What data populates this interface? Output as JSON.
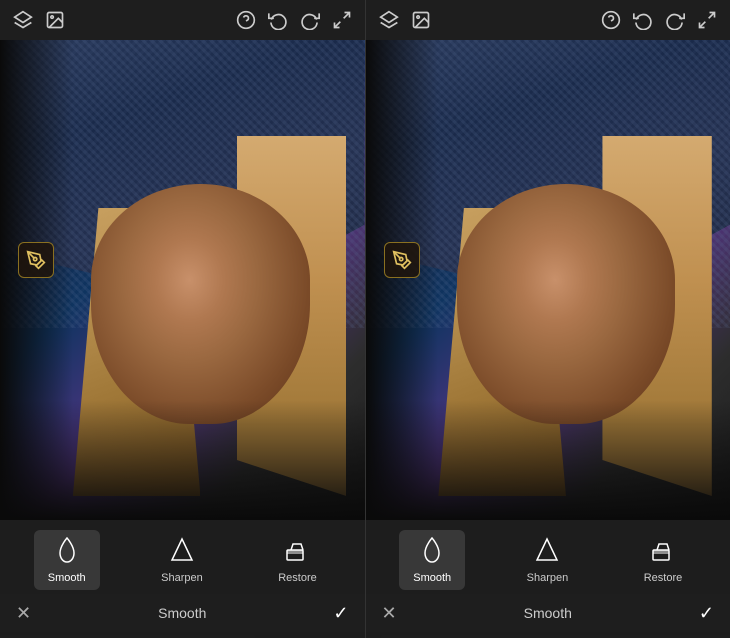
{
  "panels": [
    {
      "id": "left",
      "toolbar": {
        "left_icons": [
          "layers-icon",
          "image-icon"
        ],
        "right_icons": [
          "help-icon",
          "undo-icon",
          "redo-icon",
          "expand-icon"
        ]
      },
      "brush_indicator": true,
      "tools": [
        {
          "id": "smooth",
          "label": "Smooth",
          "icon": "drop",
          "active": true
        },
        {
          "id": "sharpen",
          "label": "Sharpen",
          "icon": "triangle"
        },
        {
          "id": "restore",
          "label": "Restore",
          "icon": "eraser"
        }
      ],
      "action_bar": {
        "cancel": "✕",
        "label": "Smooth",
        "confirm": "✓"
      }
    },
    {
      "id": "right",
      "toolbar": {
        "left_icons": [
          "layers-icon",
          "image-icon"
        ],
        "right_icons": [
          "help-icon",
          "undo-icon",
          "redo-icon",
          "expand-icon"
        ]
      },
      "brush_indicator": true,
      "tools": [
        {
          "id": "smooth",
          "label": "Smooth",
          "icon": "drop",
          "active": true
        },
        {
          "id": "sharpen",
          "label": "Sharpen",
          "icon": "triangle"
        },
        {
          "id": "restore",
          "label": "Restore",
          "icon": "eraser"
        }
      ],
      "action_bar": {
        "cancel": "✕",
        "label": "Smooth",
        "confirm": "✓"
      }
    }
  ]
}
